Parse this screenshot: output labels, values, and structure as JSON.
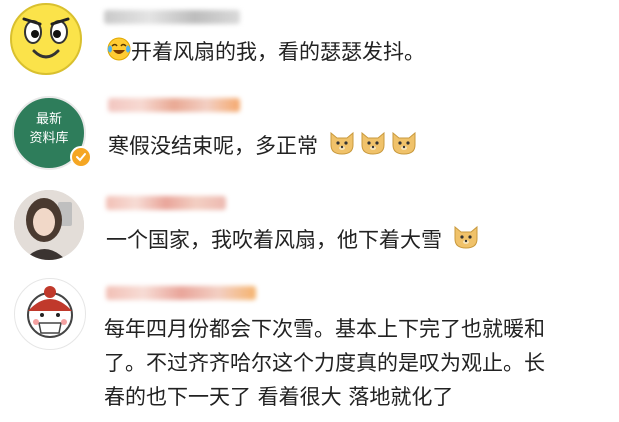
{
  "comments": [
    {
      "text": "开着风扇的我，看的瑟瑟发抖。"
    },
    {
      "avatar_text": [
        "最新",
        "资料库"
      ],
      "text": "寒假没结束呢，多正常"
    },
    {
      "text": "一个国家，我吹着风扇，他下着大雪"
    },
    {
      "text_lines": [
        "每年四月份都会下次雪。基本上下完了也就暖和",
        "了。不过齐齐哈尔这个力度真的是叹为观止。长",
        "春的也下一天了 看着很大 落地就化了"
      ]
    }
  ],
  "icons": {
    "laughing_emoji": "face-with-tears-of-joy-icon",
    "doge_emoji": "doge-icon",
    "verified_badge": "verified-badge-icon"
  },
  "colors": {
    "library_avatar_bg": "#2e7d5b",
    "verified_badge": "#f5a623",
    "blur_name": "#e8b7a6"
  }
}
